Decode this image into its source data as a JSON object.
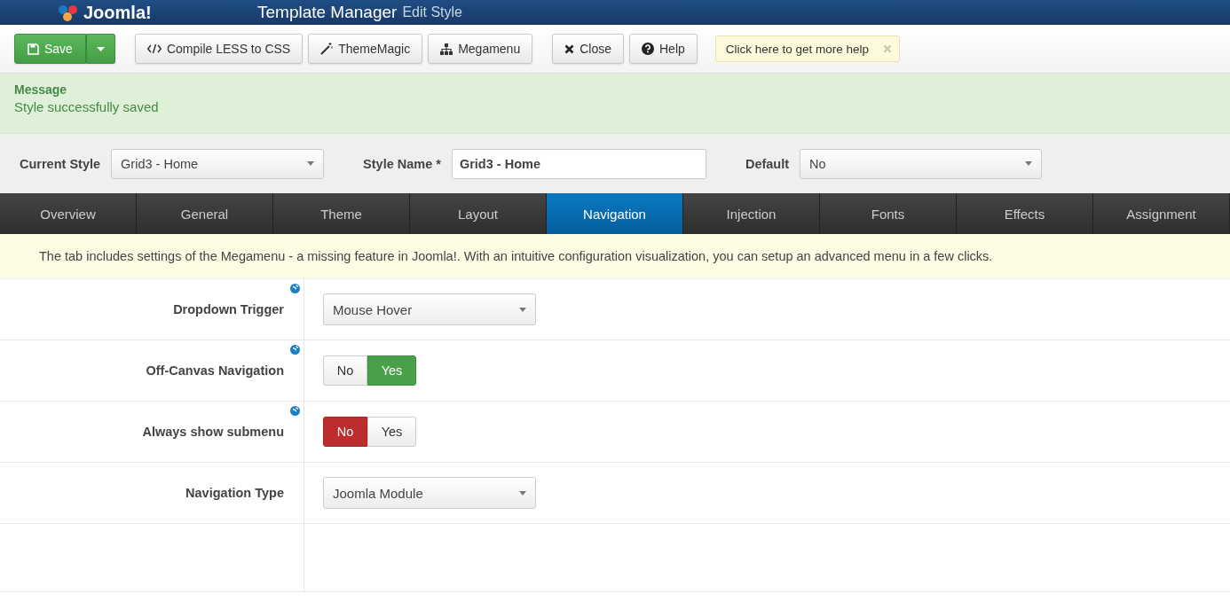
{
  "header": {
    "logo": "Joomla!",
    "title": "Template Manager",
    "subtitle": "Edit Style"
  },
  "toolbar": {
    "buttons": [
      {
        "kind": "save",
        "label": "Save"
      },
      {
        "kind": "code",
        "label": "Compile LESS to CSS"
      },
      {
        "kind": "magic",
        "label": "ThemeMagic"
      },
      {
        "kind": "sitemap",
        "label": "Megamenu"
      },
      {
        "kind": "close",
        "label": "Close"
      },
      {
        "kind": "help",
        "label": "Help"
      }
    ],
    "tip": "Click here to get more help"
  },
  "message": {
    "heading": "Message",
    "text": "Style successfully saved"
  },
  "style_bar": {
    "current_style_label": "Current Style",
    "current_style": "Grid3 - Home",
    "style_name_label": "Style Name *",
    "style_name": "Grid3 - Home",
    "default_label": "Default",
    "default": "No"
  },
  "tabs": [
    {
      "label": "Overview",
      "selected": false
    },
    {
      "label": "General",
      "selected": false
    },
    {
      "label": "Theme",
      "selected": false
    },
    {
      "label": "Layout",
      "selected": false
    },
    {
      "label": "Navigation",
      "selected": true
    },
    {
      "label": "Injection",
      "selected": false
    },
    {
      "label": "Fonts",
      "selected": false
    },
    {
      "label": "Effects",
      "selected": false
    },
    {
      "label": "Assignment",
      "selected": false
    }
  ],
  "info": "The tab includes settings of the Megamenu - a missing feature in Joomla!. With an intuitive configuration visualization, you can setup an advanced menu in a few clicks.",
  "settings": [
    {
      "kind": "select",
      "label": "Dropdown Trigger",
      "help": true,
      "value": "Mouse Hover"
    },
    {
      "kind": "toggle",
      "label": "Off-Canvas Navigation",
      "help": true,
      "options": [
        {
          "label": "No",
          "selected": false
        },
        {
          "label": "Yes",
          "selected": true
        }
      ]
    },
    {
      "kind": "toggle",
      "label": "Always show submenu",
      "help": true,
      "options": [
        {
          "label": "No",
          "selected": true
        },
        {
          "label": "Yes",
          "selected": false
        }
      ]
    },
    {
      "kind": "select",
      "label": "Navigation Type",
      "help": false,
      "value": "Joomla Module"
    }
  ]
}
